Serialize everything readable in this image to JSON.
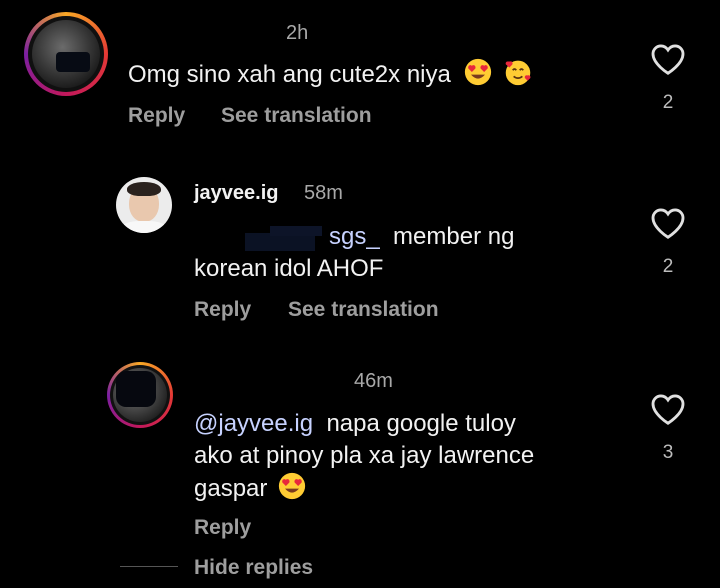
{
  "comments": [
    {
      "time": "2h",
      "text": "Omg sino xah ang cute2x niya",
      "actions": [
        "Reply",
        "See translation"
      ],
      "likes": "2"
    },
    {
      "username": "jayvee.ig",
      "time": "58m",
      "mention_partial": "sgs_",
      "text_line1": "member ng",
      "text_line2": "korean idol AHOF",
      "actions": [
        "Reply",
        "See translation"
      ],
      "likes": "2"
    },
    {
      "time": "46m",
      "mention": "@jayvee.ig",
      "text_line1": "napa google tuloy",
      "text_line2": "ako at pinoy pla xa jay lawrence",
      "text_line3": "gaspar",
      "actions": [
        "Reply"
      ],
      "likes": "3"
    }
  ],
  "hide_replies": "Hide replies",
  "icons": [
    "heart-icon",
    "heart-eyes-emoji",
    "smiling-face-with-hearts-emoji"
  ],
  "colors": {
    "background": "#000000",
    "text": "#f2f2f2",
    "muted": "#9e9e9e",
    "mention": "#c7d2ff"
  }
}
